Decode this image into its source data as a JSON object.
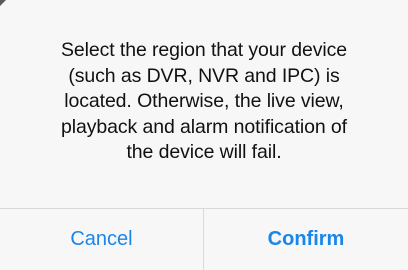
{
  "alert": {
    "message_lines": [
      "Select the region that your device",
      "(such as DVR, NVR and IPC) is",
      "located. Otherwise, the live view,",
      "playback and alarm notification of",
      "the device will fail."
    ],
    "cancel_label": "Cancel",
    "confirm_label": "Confirm"
  },
  "colors": {
    "background": "#f7f7f7",
    "text": "#111111",
    "accent": "#1a86ea",
    "divider": "#d9d9d9"
  }
}
